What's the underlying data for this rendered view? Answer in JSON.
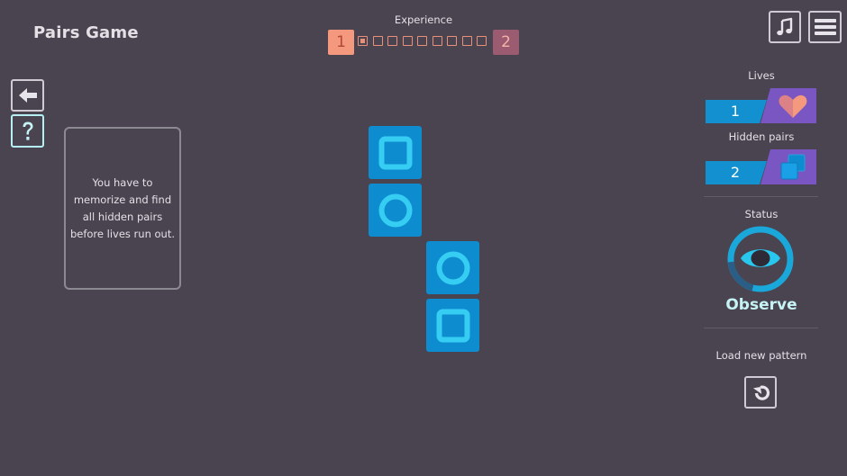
{
  "header": {
    "title": "Pairs Game",
    "experience_label": "Experience",
    "current_level": "1",
    "next_level": "2",
    "progress_segments": 10,
    "progress_filled": 1
  },
  "sidebar": {
    "back_icon": "arrow-left-icon",
    "help_icon": "question-mark-icon"
  },
  "info": {
    "line1": "You have to",
    "line2": "memorize and find",
    "line3": "all hidden pairs",
    "line4": "before lives run out."
  },
  "board": {
    "tiles": [
      {
        "symbol": "square"
      },
      {
        "symbol": "circle"
      },
      {
        "symbol": "circle"
      },
      {
        "symbol": "square"
      }
    ]
  },
  "panel": {
    "lives_label": "Lives",
    "lives_value": "1",
    "lives_icon": "heart-icon",
    "pairs_label": "Hidden pairs",
    "pairs_value": "2",
    "pairs_icon": "pairs-icon",
    "status_label": "Status",
    "status_value": "Observe",
    "status_icon": "eye-icon",
    "load_label": "Load new pattern",
    "load_icon": "reload-icon"
  },
  "colors": {
    "background": "#4a4450",
    "tile": "#0e8cd0",
    "tile_symbol": "#35cdf2",
    "accent_purple": "#7a56c2",
    "counter_blue": "#1290cf",
    "status_ring": "#1aa7d9",
    "xp_orange": "#f4987e",
    "xp_next": "#9b5b70"
  }
}
